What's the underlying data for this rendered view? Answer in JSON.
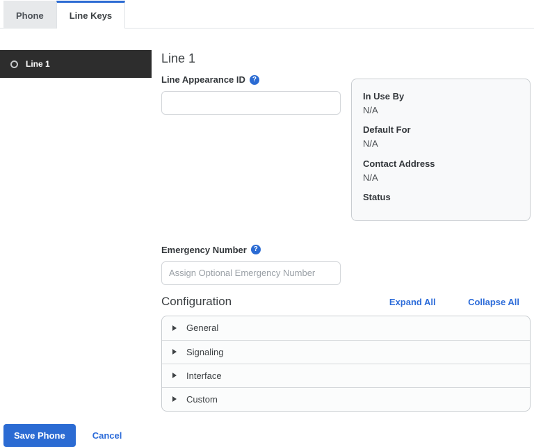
{
  "tabs": [
    {
      "label": "Phone",
      "active": false
    },
    {
      "label": "Line Keys",
      "active": true
    }
  ],
  "sidebar": {
    "items": [
      {
        "label": "Line 1",
        "icon": "radio-circle-icon",
        "selected": true
      }
    ]
  },
  "main": {
    "heading": "Line 1",
    "line_appearance": {
      "label": "Line Appearance ID",
      "help_icon": "question-circle-icon",
      "help_glyph": "?",
      "value": ""
    },
    "info_panel": {
      "fields": [
        {
          "label": "In Use By",
          "value": "N/A"
        },
        {
          "label": "Default For",
          "value": "N/A"
        },
        {
          "label": "Contact Address",
          "value": "N/A"
        },
        {
          "label": "Status",
          "value": ""
        }
      ]
    },
    "emergency": {
      "label": "Emergency Number",
      "help_icon": "question-circle-icon",
      "help_glyph": "?",
      "value": "",
      "placeholder": "Assign Optional Emergency Number"
    },
    "configuration": {
      "heading": "Configuration",
      "expand_all": "Expand All",
      "collapse_all": "Collapse All",
      "sections": [
        {
          "label": "General",
          "expanded": false
        },
        {
          "label": "Signaling",
          "expanded": false
        },
        {
          "label": "Interface",
          "expanded": false
        },
        {
          "label": "Custom",
          "expanded": false
        }
      ]
    }
  },
  "footer": {
    "save_label": "Save Phone",
    "cancel_label": "Cancel"
  },
  "colors": {
    "accent_blue": "#2b6bd3",
    "link_blue": "#2d6cd9",
    "sidebar_bg": "#2d2d2d",
    "tab_inactive_bg": "#e7e9eb",
    "panel_bg": "#f8f9fa",
    "panel_border": "#c9cdd1",
    "input_border": "#d3d6da"
  }
}
